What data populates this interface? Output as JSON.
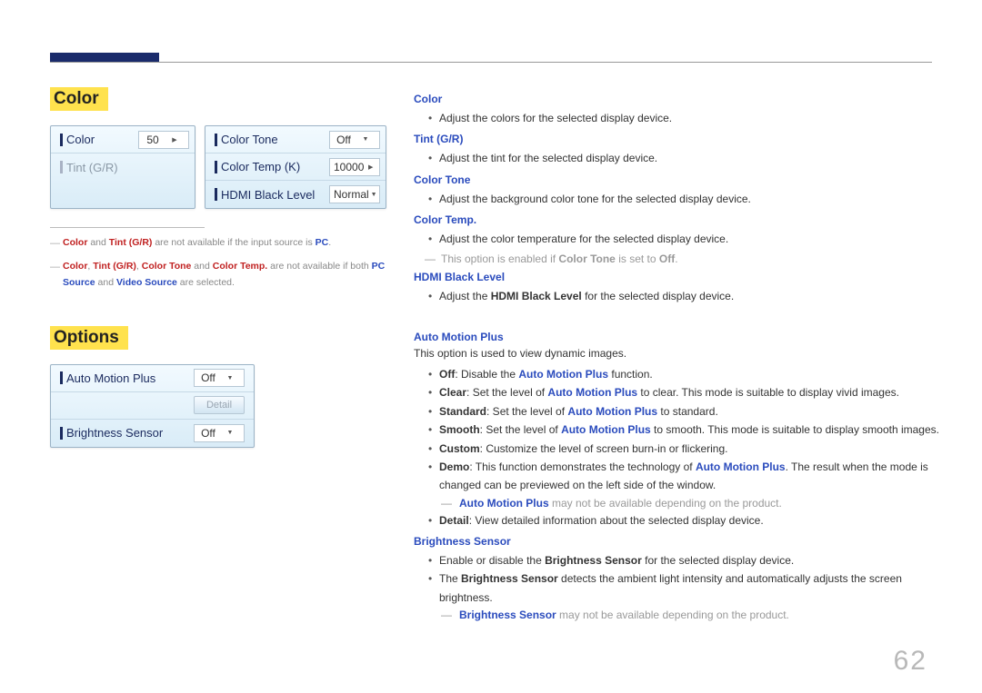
{
  "page": {
    "number": "62"
  },
  "left": {
    "colorTitle": "Color",
    "optionsTitle": "Options",
    "panelColor": {
      "row1Label": "Color",
      "row1Value": "50",
      "row2Label": "Tint (G/R)",
      "right1Label": "Color Tone",
      "right1Value": "Off",
      "right2Label": "Color Temp (K)",
      "right2Value": "10000",
      "right3Label": "HDMI Black Level",
      "right3Value": "Normal"
    },
    "panelOptions": {
      "row1Label": "Auto Motion Plus",
      "row1Value": "Off",
      "row2Btn": "Detail",
      "row3Label": "Brightness Sensor",
      "row3Value": "Off"
    },
    "foot1": {
      "a": "Color",
      "b": " and ",
      "c": "Tint (G/R)",
      "d": " are not available if the input source is ",
      "e": "PC",
      "f": "."
    },
    "foot2": {
      "a": "Color",
      "comma1": ", ",
      "b": "Tint (G/R)",
      "comma2": ", ",
      "c": "Color Tone",
      "and": " and ",
      "d": "Color Temp.",
      "rest1": " are not available if both ",
      "e": "PC Source",
      "and2": " and ",
      "f": "Video Source",
      "rest2": " are selected."
    }
  },
  "right": {
    "color": {
      "h": "Color",
      "li": "Adjust the colors for the selected display device."
    },
    "tint": {
      "h": "Tint (G/R)",
      "li": "Adjust the tint for the selected display device."
    },
    "tone": {
      "h": "Color Tone",
      "li": "Adjust the background color tone for the selected display device."
    },
    "temp": {
      "h": "Color Temp.",
      "li": "Adjust the color temperature for the selected display device.",
      "noteA": "This option is enabled if ",
      "noteB": "Color Tone",
      "noteC": " is set to ",
      "noteD": "Off",
      "noteE": "."
    },
    "hdmi": {
      "h": "HDMI Black Level",
      "liA": "Adjust the ",
      "liB": "HDMI Black Level",
      "liC": " for the selected display device."
    },
    "amp": {
      "h": "Auto Motion Plus",
      "intro": "This option is used to view dynamic images.",
      "li1a": "Off",
      "li1b": ": Disable the ",
      "li1c": "Auto Motion Plus",
      "li1d": " function.",
      "li2a": "Clear",
      "li2b": ": Set the level of ",
      "li2c": "Auto Motion Plus",
      "li2d": " to clear. This mode is suitable to display vivid images.",
      "li3a": "Standard",
      "li3b": ": Set the level of ",
      "li3c": "Auto Motion Plus",
      "li3d": " to standard.",
      "li4a": "Smooth",
      "li4b": ": Set the level of ",
      "li4c": "Auto Motion Plus",
      "li4d": " to smooth. This mode is suitable to display smooth images.",
      "li5a": "Custom",
      "li5b": ": Customize the level of screen burn-in or flickering.",
      "li6a": "Demo",
      "li6b": ": This function demonstrates the technology of ",
      "li6c": "Auto Motion Plus",
      "li6d": ". The result when the mode is changed can be previewed on the left side of the window.",
      "noteA": "Auto Motion Plus",
      "noteB": " may not be available depending on the product.",
      "li7a": "Detail",
      "li7b": ": View detailed information about the selected display device."
    },
    "bs": {
      "h": "Brightness Sensor",
      "li1a": "Enable or disable the ",
      "li1b": "Brightness Sensor",
      "li1c": " for the selected display device.",
      "li2a": "The ",
      "li2b": "Brightness Sensor",
      "li2c": " detects the ambient light intensity and automatically adjusts the screen brightness.",
      "noteA": "Brightness Sensor",
      "noteB": " may not be available depending on the product."
    }
  }
}
